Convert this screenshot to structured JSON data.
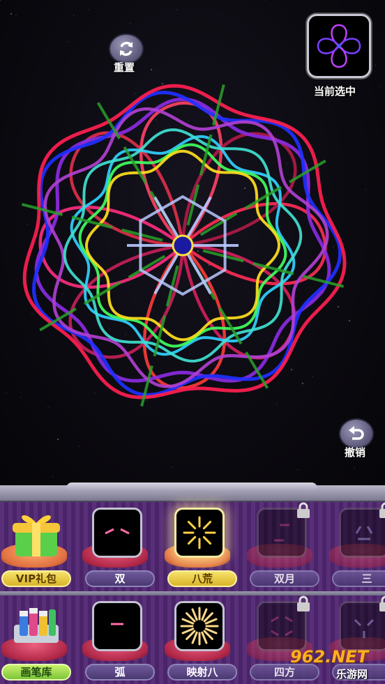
{
  "controls": {
    "reset_label": "重置",
    "current_label": "当前选中",
    "undo_label": "撤销"
  },
  "icons": {
    "reset": "refresh-icon",
    "undo": "undo-arrow-icon",
    "lock": "padlock-icon",
    "gift": "gift-box-icon",
    "brushes": "paint-bottles-icon"
  },
  "brush_rows": [
    {
      "shop": {
        "label": "VIP礼包",
        "icon": "gift-box-icon"
      },
      "slots": [
        {
          "label": "双",
          "locked": false,
          "selected": false
        },
        {
          "label": "八荒",
          "locked": false,
          "selected": true
        },
        {
          "label": "双月",
          "locked": true,
          "selected": false
        },
        {
          "label": "三",
          "locked": true,
          "selected": false
        }
      ]
    },
    {
      "shop": {
        "label": "画笔库",
        "icon": "paint-bottles-icon"
      },
      "slots": [
        {
          "label": "弧",
          "locked": false,
          "selected": false
        },
        {
          "label": "映射八",
          "locked": false,
          "selected": false
        },
        {
          "label": "四方",
          "locked": true,
          "selected": false
        },
        {
          "label": "",
          "locked": true,
          "selected": false
        }
      ]
    }
  ],
  "watermark": {
    "brand": "962.NET",
    "sub": "乐游网"
  },
  "colors": {
    "background": "#07060c",
    "panel": "#4a2468",
    "selected_glow": "#fff096"
  }
}
